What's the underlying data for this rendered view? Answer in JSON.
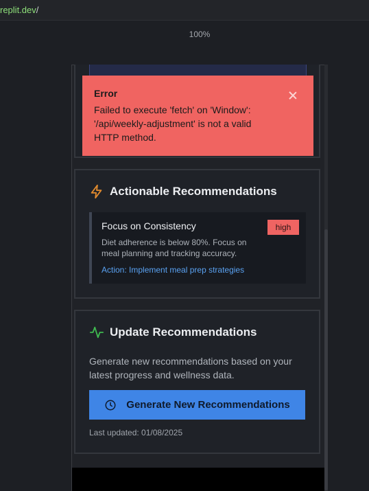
{
  "browser": {
    "url_host": "replit.dev",
    "url_path": "/",
    "zoom": "100%"
  },
  "toast": {
    "title": "Error",
    "message": "Failed to execute 'fetch' on 'Window': '/api/weekly-adjustment' is not a valid HTTP method."
  },
  "recommendations": {
    "title": "Actionable Recommendations",
    "item": {
      "title": "Focus on Consistency",
      "badge": "high",
      "description": "Diet adherence is below 80%. Focus on meal planning and tracking accuracy.",
      "action": "Action: Implement meal prep strategies"
    }
  },
  "update": {
    "title": "Update Recommendations",
    "description": "Generate new recommendations based on your latest progress and wellness data.",
    "button_label": "Generate New Recommendations",
    "last_updated": "Last updated: 01/08/2025"
  },
  "colors": {
    "accent_blue": "#3f85e6",
    "error_red": "#f06461",
    "icon_orange": "#e08a2e",
    "icon_green": "#3fb950"
  },
  "icons": {
    "recs": "lightning-icon",
    "update": "activity-icon",
    "button": "clock-icon",
    "close": "close-icon"
  }
}
